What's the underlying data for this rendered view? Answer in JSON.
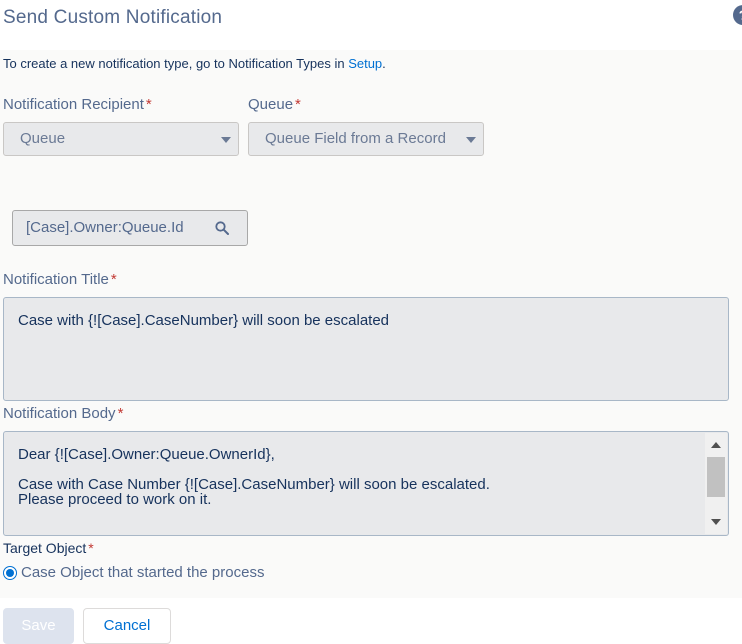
{
  "dialog": {
    "title": "Send Custom Notification",
    "help_icon": "?"
  },
  "info": {
    "text": "To create a new notification type, go to Notification Types in ",
    "link": "Setup",
    "suffix": "."
  },
  "recipient": {
    "label": "Notification Recipient",
    "required": "*",
    "value": "Queue"
  },
  "queue": {
    "label": "Queue",
    "required": "*",
    "value": "Queue Field from a Record"
  },
  "queue_field": {
    "value": "[Case].Owner:Queue.Id"
  },
  "title_field": {
    "label": "Notification Title",
    "required": "*",
    "value": "Case with {![Case].CaseNumber} will soon be escalated"
  },
  "body_field": {
    "label": "Notification Body",
    "required": "*",
    "line1": "Dear {![Case].Owner:Queue.OwnerId},",
    "line2": "Case with Case Number {![Case].CaseNumber} will soon be escalated.",
    "line3": "Please proceed to work on it."
  },
  "target": {
    "label": "Target Object",
    "required": "*",
    "option": "Case Object that started the process",
    "selected": true
  },
  "buttons": {
    "save": "Save",
    "cancel": "Cancel"
  },
  "colors": {
    "accent": "#0070d2",
    "required": "#c23934",
    "label": "#54698d"
  },
  "icons": {
    "search": "search-icon",
    "caret": "chevron-down-icon"
  }
}
